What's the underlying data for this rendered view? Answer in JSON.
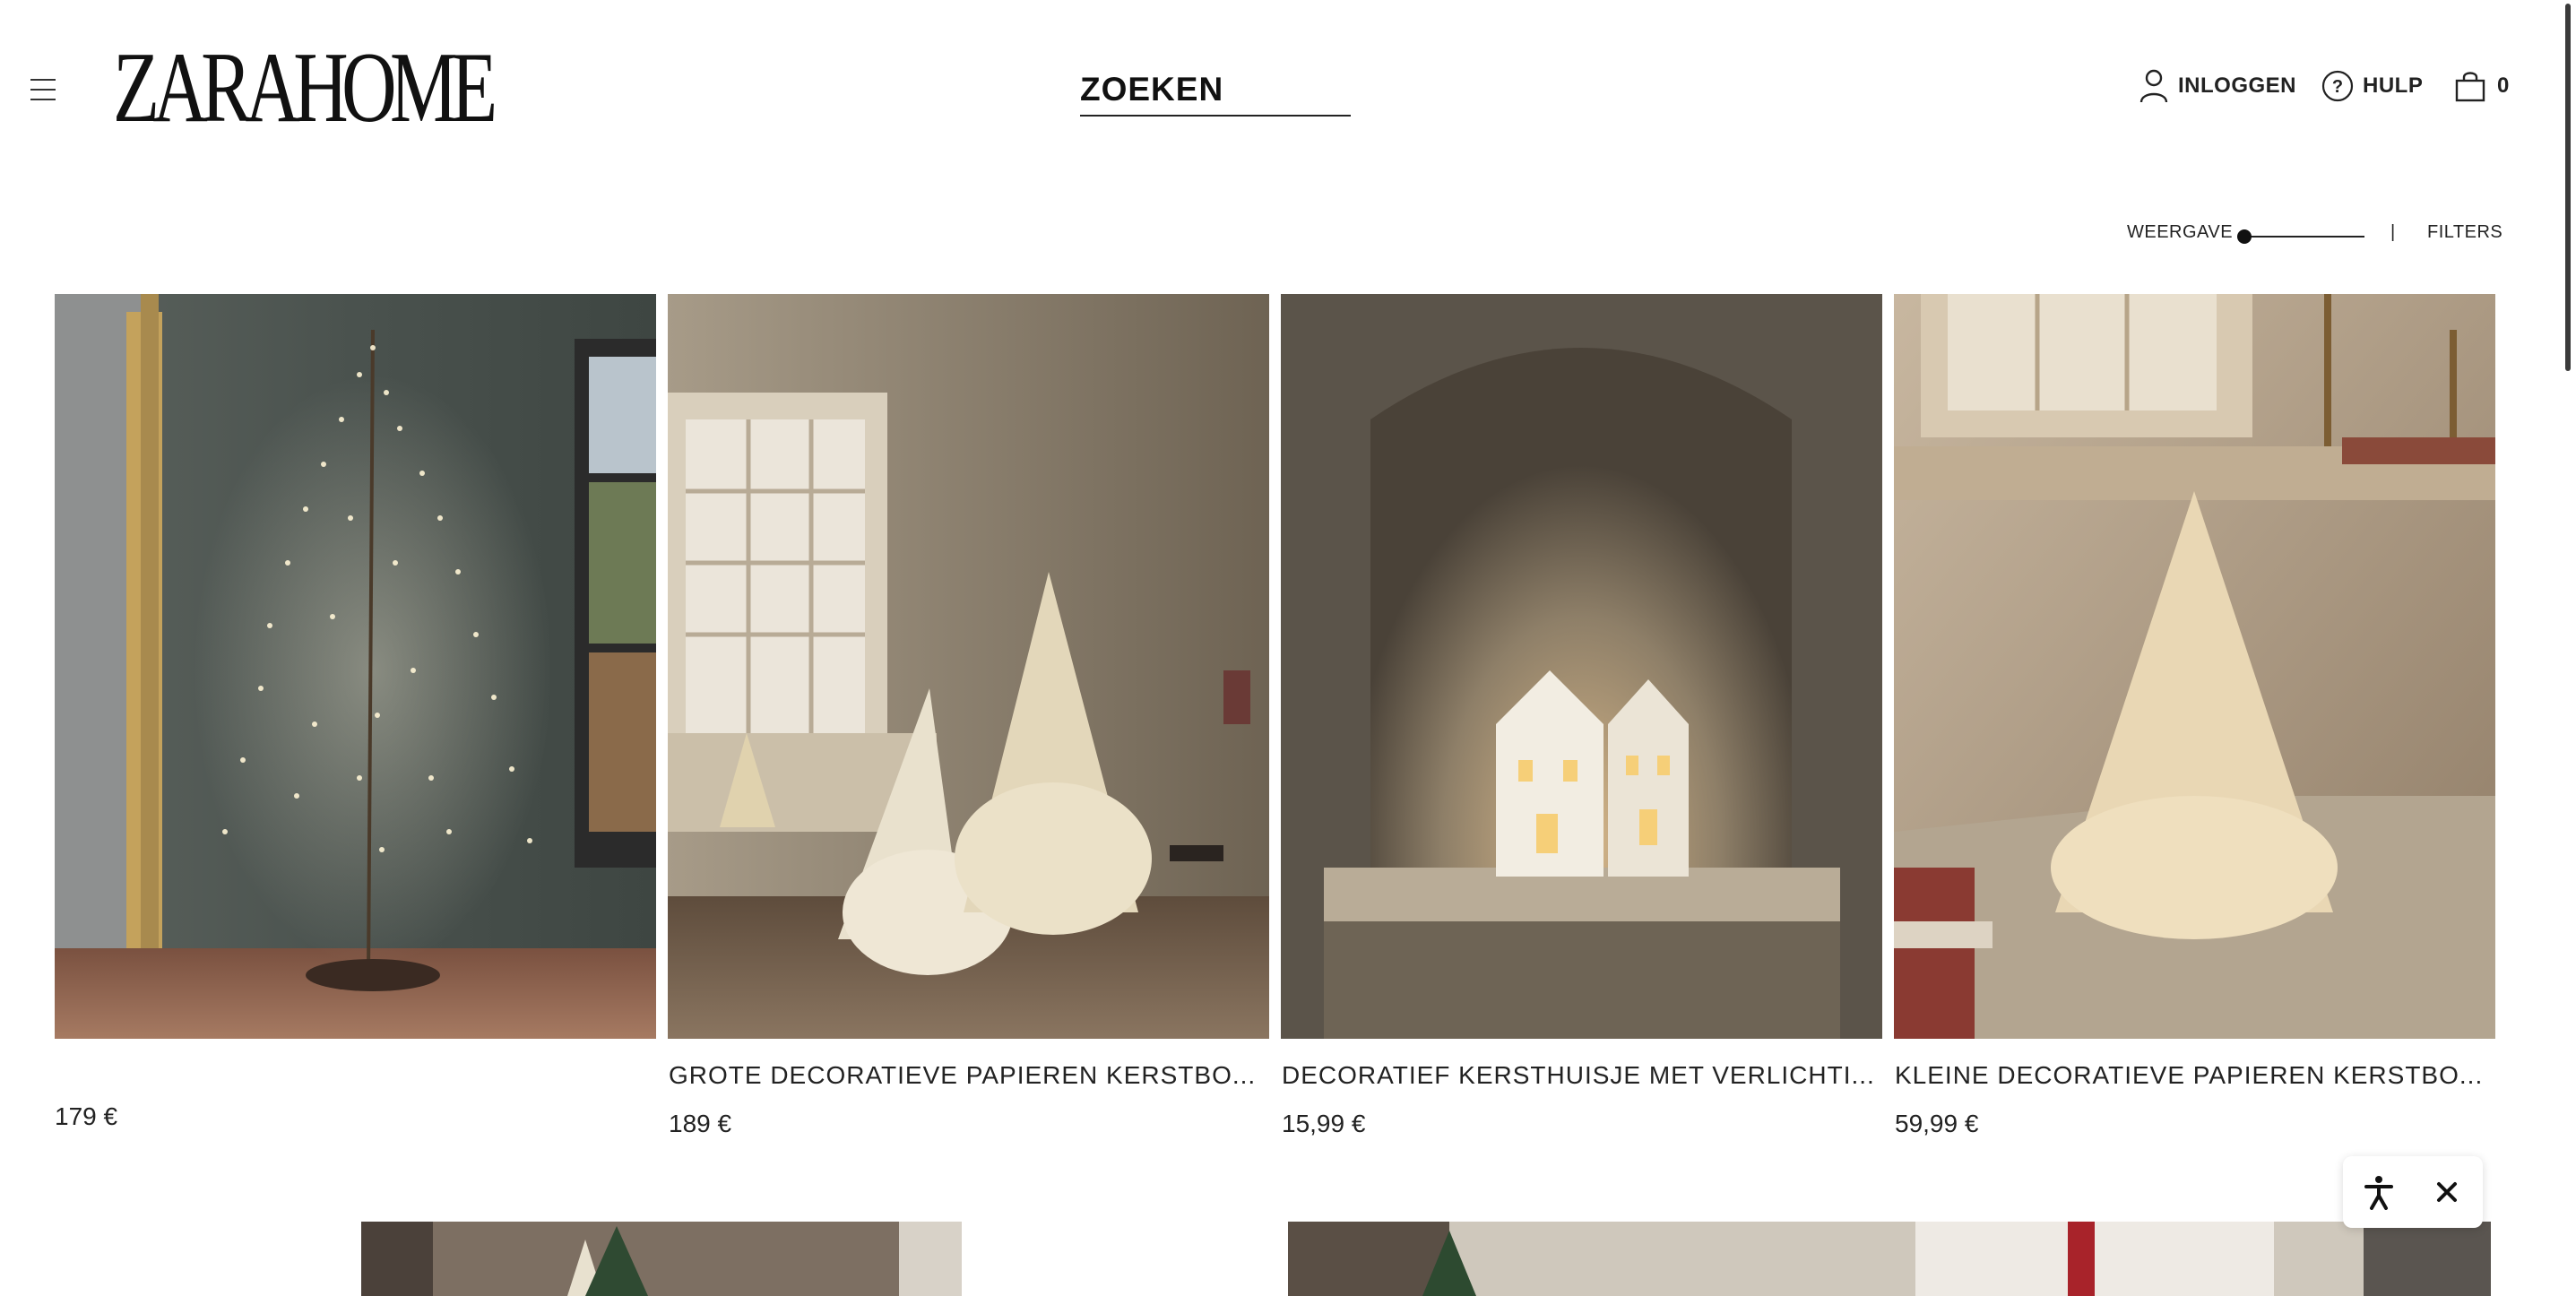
{
  "header": {
    "logo_text": "ZARAHOME",
    "search_label": "ZOEKEN",
    "login_label": "INLOGGEN",
    "help_label": "HULP",
    "cart_count": "0"
  },
  "toolbar": {
    "view_label": "WEERGAVE",
    "separator": "|",
    "filters_label": "FILTERS"
  },
  "products": [
    {
      "name": "",
      "price": "179 €"
    },
    {
      "name": "GROTE DECORATIEVE PAPIEREN KERSTBO...",
      "price": "189 €"
    },
    {
      "name": "DECORATIEF KERSTHUISJE MET VERLICHTI...",
      "price": "15,99 €"
    },
    {
      "name": "KLEINE DECORATIEVE PAPIEREN KERSTBO...",
      "price": "59,99 €"
    }
  ],
  "icons": {
    "menu": "hamburger-menu-icon",
    "user": "user-icon",
    "help": "help-icon",
    "cart": "shopping-bag-icon",
    "accessibility": "accessibility-icon",
    "close": "close-icon"
  },
  "colors": {
    "text": "#1a1a1a",
    "background": "#ffffff"
  }
}
